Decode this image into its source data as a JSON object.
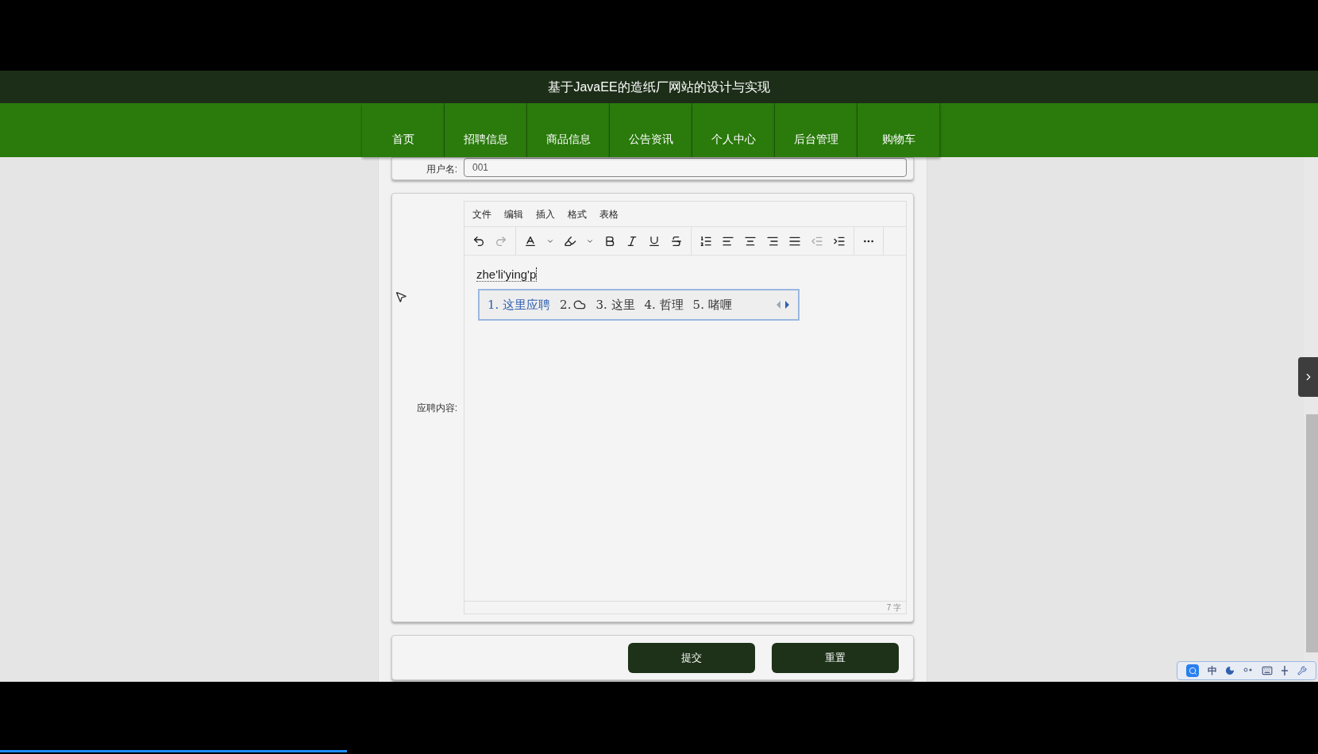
{
  "header": {
    "title": "基于JavaEE的造纸厂网站的设计与实现"
  },
  "nav": [
    {
      "label": "首页"
    },
    {
      "label": "招聘信息"
    },
    {
      "label": "商品信息"
    },
    {
      "label": "公告资讯"
    },
    {
      "label": "个人中心"
    },
    {
      "label": "后台管理"
    },
    {
      "label": "购物车"
    }
  ],
  "username": {
    "label": "用户名:",
    "value": "001"
  },
  "editor": {
    "label": "应聘内容:",
    "menus": [
      "文件",
      "编辑",
      "插入",
      "格式",
      "表格"
    ],
    "text": "zhe'li'ying'p",
    "word_count": "7 字"
  },
  "ime": {
    "candidates": [
      {
        "index": "1.",
        "text": "这里应聘",
        "selected": true,
        "kind": "text"
      },
      {
        "index": "2.",
        "kind": "cloud"
      },
      {
        "index": "3.",
        "text": "这里",
        "selected": false,
        "kind": "text"
      },
      {
        "index": "4.",
        "text": "哲理",
        "selected": false,
        "kind": "text"
      },
      {
        "index": "5.",
        "text": "啫喱",
        "selected": false,
        "kind": "text"
      }
    ],
    "mode": "中"
  },
  "buttons": [
    "提交",
    "重置"
  ],
  "video": {
    "level": 0.263
  }
}
